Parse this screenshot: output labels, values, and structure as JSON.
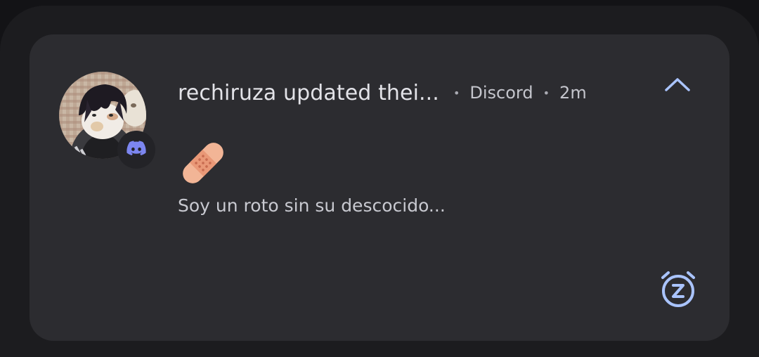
{
  "notification": {
    "title": "rechiruza updated thei...",
    "app_name": "Discord",
    "time": "2m",
    "separator": "•",
    "body": "Soy un roto sin su descocido...",
    "emoji_icon": "adhesive-bandage-icon",
    "avatar_icon": "user-avatar",
    "app_icon": "discord-icon",
    "expand_icon": "chevron-up-icon",
    "snooze_icon": "snooze-alarm-icon"
  },
  "colors": {
    "background": "#131316",
    "panel": "#1c1c1f",
    "card": "#2c2c30",
    "title_text": "#e3e3e8",
    "meta_text": "#c4c5cc",
    "accent": "#aac4ff",
    "discord_blurple": "#7c86f0"
  }
}
